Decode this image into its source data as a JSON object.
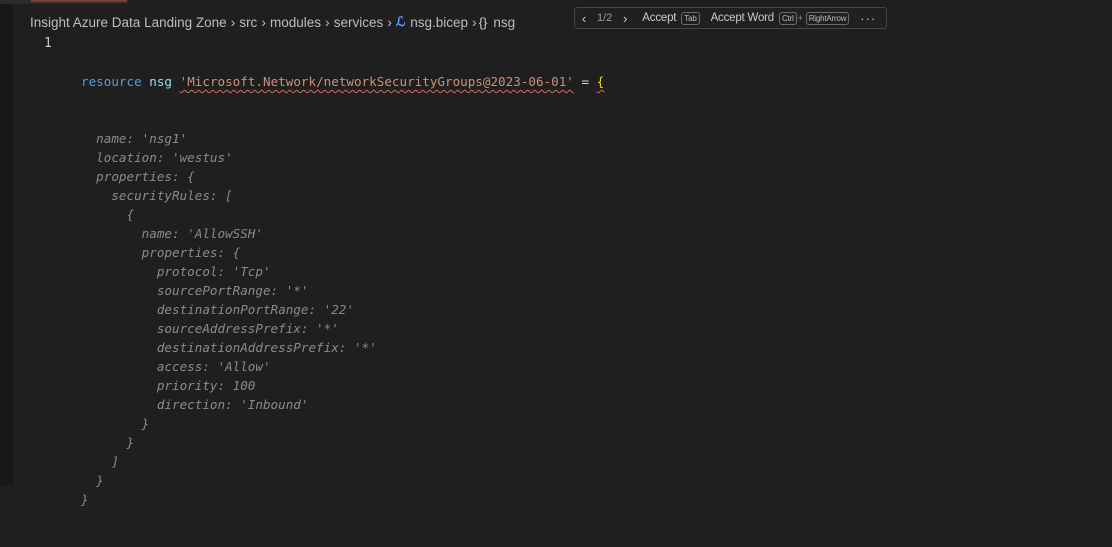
{
  "breadcrumb": {
    "items": [
      "Insight Azure Data Landing Zone",
      "src",
      "modules",
      "services",
      "nsg.bicep",
      "nsg"
    ]
  },
  "suggestion_widget": {
    "counter": "1/2",
    "accept_label": "Accept",
    "accept_key": "Tab",
    "accept_word_label": "Accept Word",
    "accept_word_key_1": "Ctrl",
    "accept_word_plus": "+",
    "accept_word_key_2": "RightArrow",
    "more_icon": "ellipsis-icon"
  },
  "editor": {
    "line_number": "1",
    "line1": {
      "keyword": "resource",
      "identifier": "nsg",
      "type_string": "'Microsoft.Network/networkSecurityGroups@2023-06-01'",
      "equals": "=",
      "brace": "{"
    },
    "ghost_lines": [
      "  name: 'nsg1'",
      "  location: 'westus'",
      "  properties: {",
      "    securityRules: [",
      "      {",
      "        name: 'AllowSSH'",
      "        properties: {",
      "          protocol: 'Tcp'",
      "          sourcePortRange: '*'",
      "          destinationPortRange: '22'",
      "          sourceAddressPrefix: '*'",
      "          destinationAddressPrefix: '*'",
      "          access: 'Allow'",
      "          priority: 100",
      "          direction: 'Inbound'",
      "        }",
      "      }",
      "    ]",
      "  }",
      "}"
    ]
  }
}
